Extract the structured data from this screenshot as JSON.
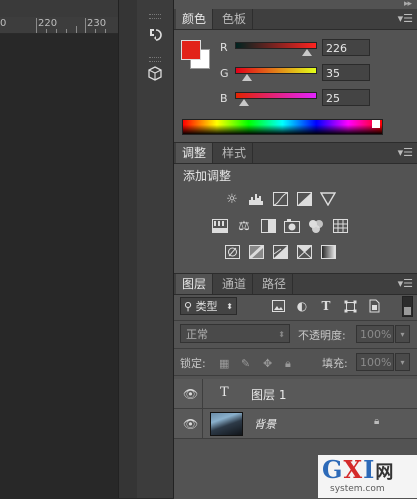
{
  "ruler": {
    "labels": [
      "0",
      "220",
      "230"
    ]
  },
  "tools": {
    "history_icon": "history-brush-icon",
    "properties_icon": "cube-properties-icon"
  },
  "color_panel": {
    "tabs": [
      "颜色",
      "色板"
    ],
    "active_tab": "颜色",
    "foreground": "#e2231a",
    "background": "#ffffff",
    "channels": [
      {
        "label": "R",
        "value": "226",
        "level": 0.886
      },
      {
        "label": "G",
        "value": "35",
        "level": 0.137
      },
      {
        "label": "B",
        "value": "25",
        "level": 0.098
      }
    ]
  },
  "adjust_panel": {
    "tabs": [
      "调整",
      "样式"
    ],
    "active_tab": "调整",
    "title": "添加调整",
    "icons": [
      "brightness-icon",
      "levels-icon",
      "curves-icon",
      "exposure-icon",
      "vibrance-icon",
      "hue-saturation-icon",
      "color-balance-icon",
      "black-white-icon",
      "photo-filter-icon",
      "channel-mixer-icon",
      "color-lookup-icon",
      "invert-icon",
      "posterize-icon",
      "threshold-icon",
      "selective-color-icon",
      "gradient-map-icon"
    ]
  },
  "layers_panel": {
    "tabs": [
      "图层",
      "通道",
      "路径"
    ],
    "active_tab": "图层",
    "filter_label": "类型",
    "blend_mode": "正常",
    "opacity_label": "不透明度:",
    "opacity_value": "100%",
    "lock_label": "锁定:",
    "fill_label": "填充:",
    "fill_value": "100%",
    "layers": [
      {
        "name": "图层 1",
        "type": "text"
      },
      {
        "name": "背景",
        "type": "image",
        "locked": true
      }
    ]
  },
  "watermark": {
    "logo_g": "G",
    "logo_x": "X",
    "logo_i": "I",
    "logo_cn": "网",
    "site": "system.com"
  }
}
